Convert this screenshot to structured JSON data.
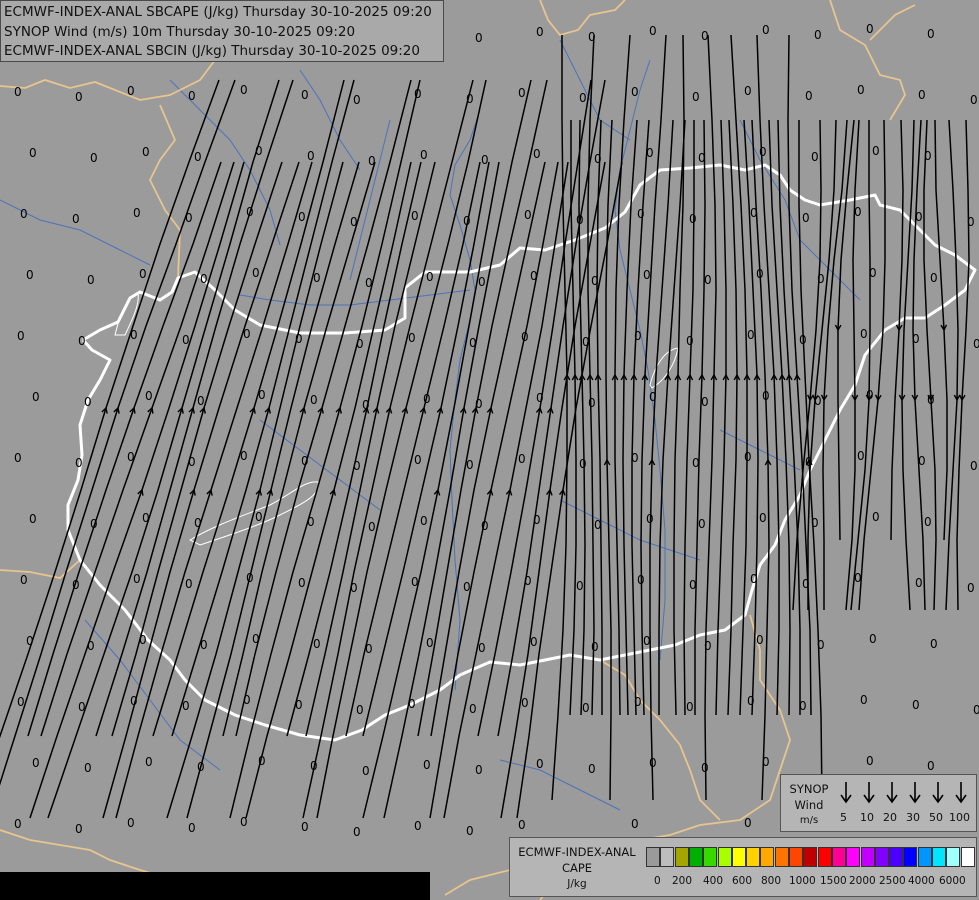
{
  "titles": [
    "ECMWF-INDEX-ANAL SBCAPE (J/kg) Thursday 30-10-2025 09:20",
    "SYNOP Wind (m/s) 10m Thursday 30-10-2025 09:20",
    "ECMWF-INDEX-ANAL SBCIN (J/kg) Thursday 30-10-2025 09:20"
  ],
  "colors": {
    "background": "#9b9b9b",
    "national_border": "#ffffff",
    "foreign_border": "#e6c58f",
    "rivers": "#4d73b8",
    "streamlines": "#000000",
    "field_labels": "#000000"
  },
  "map": {
    "field_value_label": "0",
    "cape_shading": "none (all values 0)"
  },
  "legend_wind": {
    "title_lines": [
      "SYNOP",
      "Wind",
      "m/s"
    ],
    "values": [
      "5",
      "10",
      "20",
      "30",
      "50",
      "100"
    ]
  },
  "legend_cape": {
    "title_lines": [
      "ECMWF-INDEX-ANAL",
      "CAPE",
      "J/kg"
    ],
    "swatch_colors": [
      "#9a9a9a",
      "#bdbdbd",
      "#a5a500",
      "#00b000",
      "#36d900",
      "#a8ff00",
      "#ffff00",
      "#ffd100",
      "#ffa800",
      "#ff7400",
      "#ff4600",
      "#c00000",
      "#ff0000",
      "#ff0096",
      "#ff00ff",
      "#c200ff",
      "#8200ff",
      "#4b00ff",
      "#0000ff",
      "#0096ff",
      "#00e6ff",
      "#a0ffff",
      "#ffffff"
    ],
    "tick_labels": [
      "0",
      "200",
      "400",
      "600",
      "800",
      "1000",
      "1500",
      "2000",
      "2500",
      "4000",
      "6000"
    ]
  }
}
